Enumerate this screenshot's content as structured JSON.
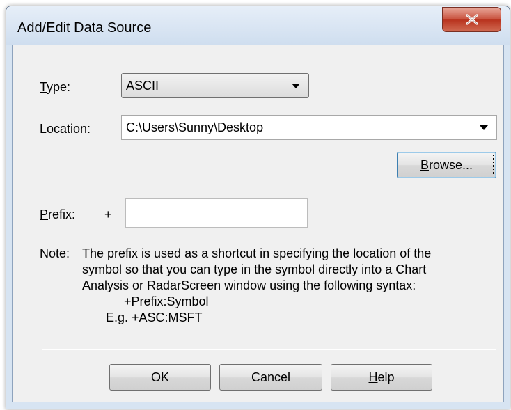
{
  "window": {
    "title": "Add/Edit Data Source",
    "close_glyph": "X"
  },
  "type_field": {
    "label_accel": "T",
    "label_rest": "ype:",
    "value": "ASCII"
  },
  "location_field": {
    "label_accel": "L",
    "label_rest": "ocation:",
    "value": "C:\\Users\\Sunny\\Desktop"
  },
  "browse_button": {
    "accel": "B",
    "rest": "rowse..."
  },
  "prefix_field": {
    "label_accel": "P",
    "label_rest": "refix:",
    "plus": "+",
    "value": ""
  },
  "note": {
    "lead": "Note:",
    "line1": "The prefix is used as a shortcut in specifying the location of the",
    "line2": "symbol so that you can type in the symbol directly into a Chart",
    "line3": "Analysis or RadarScreen window using the following syntax:",
    "syntax": "+Prefix:Symbol",
    "example": "E.g. +ASC:MSFT"
  },
  "buttons": {
    "ok": "OK",
    "cancel": "Cancel",
    "help_accel": "H",
    "help_rest": "elp"
  },
  "icons": {
    "close": "close-icon",
    "dropdown": "chevron-down-icon"
  }
}
